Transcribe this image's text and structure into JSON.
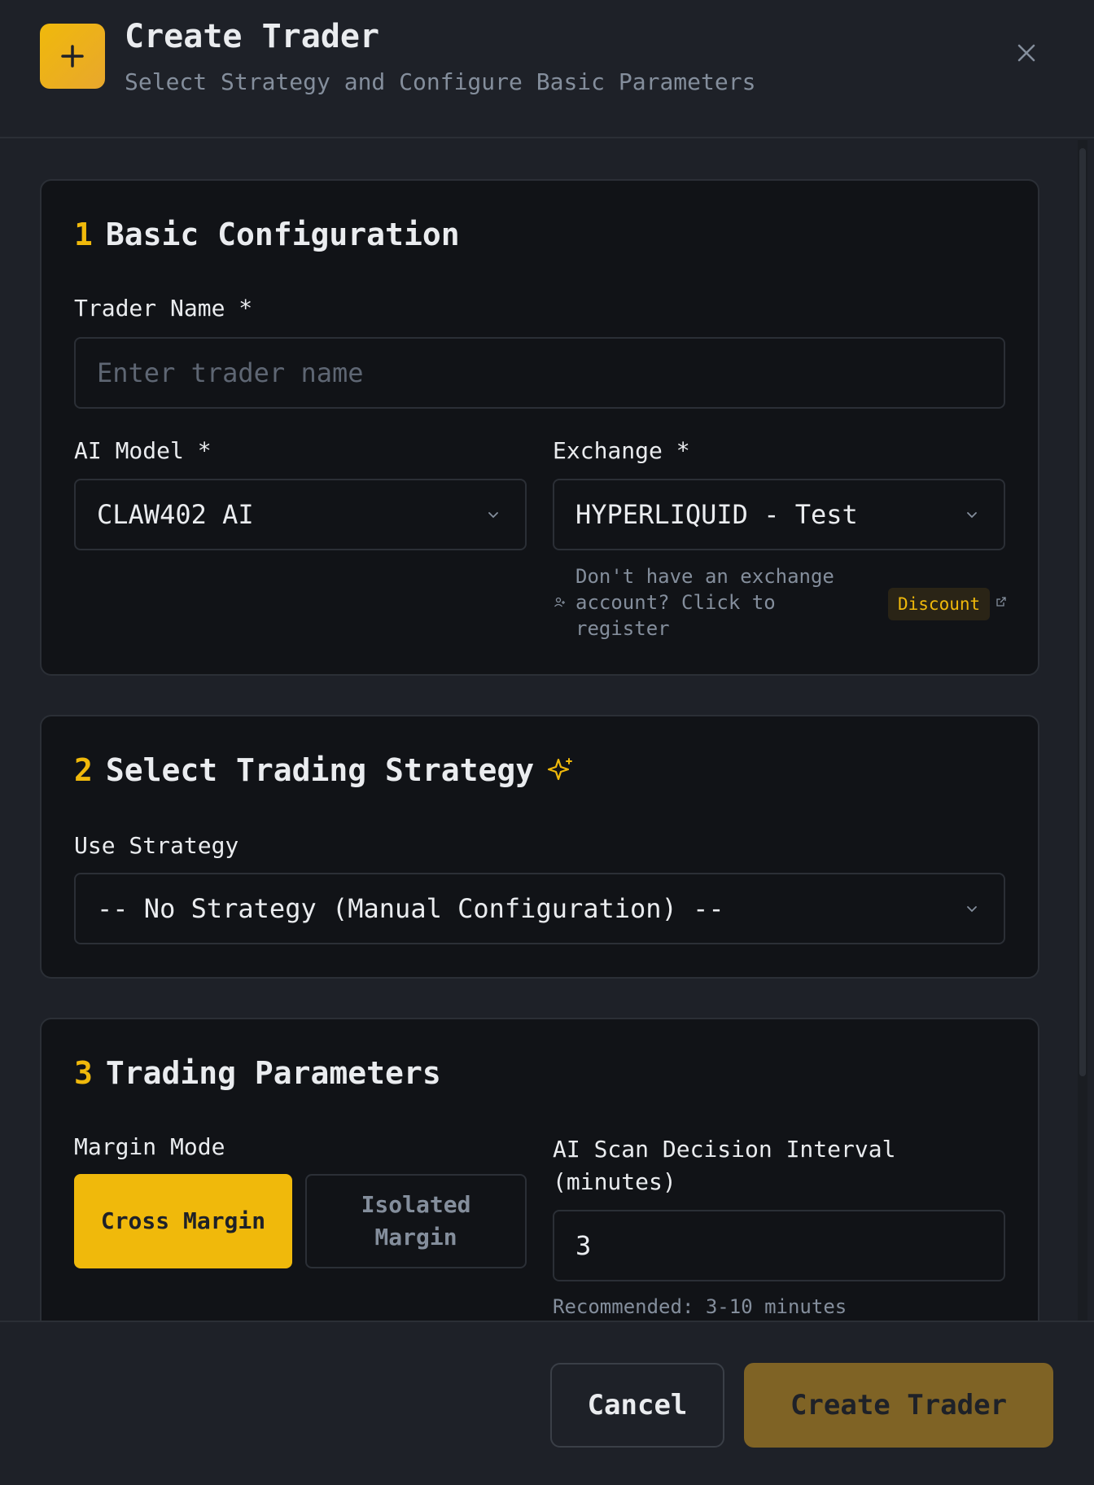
{
  "header": {
    "title": "Create Trader",
    "subtitle": "Select Strategy and Configure Basic Parameters"
  },
  "section1": {
    "number": "1",
    "title": "Basic Configuration",
    "trader_name_label": "Trader Name *",
    "trader_name_placeholder": "Enter trader name",
    "ai_model_label": "AI Model *",
    "ai_model_value": "CLAW402 AI",
    "exchange_label": "Exchange *",
    "exchange_value": "HYPERLIQUID - Test",
    "register_hint_line1": "Don't have an exchange",
    "register_hint_line2": "account? Click to",
    "register_hint_line3": "register",
    "discount_badge": "Discount"
  },
  "section2": {
    "number": "2",
    "title": "Select Trading Strategy",
    "use_strategy_label": "Use Strategy",
    "strategy_value": "-- No Strategy (Manual Configuration) --"
  },
  "section3": {
    "number": "3",
    "title": "Trading Parameters",
    "margin_mode_label": "Margin Mode",
    "cross_margin": "Cross Margin",
    "isolated_margin_line1": "Isolated",
    "isolated_margin_line2": "Margin",
    "selected_margin_mode": "Cross Margin",
    "interval_label_line1": "AI Scan Decision Interval",
    "interval_label_line2": "(minutes)",
    "interval_value": "3",
    "interval_hint": "Recommended: 3-10 minutes"
  },
  "footer": {
    "cancel_label": "Cancel",
    "create_label": "Create Trader"
  },
  "colors": {
    "accent": "#f0b90b",
    "background": "#1e2128",
    "card": "#111317"
  }
}
